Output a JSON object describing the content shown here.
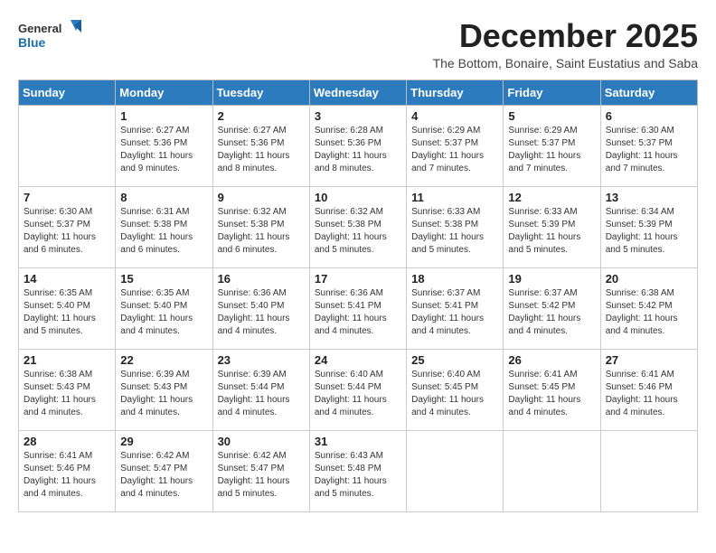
{
  "header": {
    "logo_general": "General",
    "logo_blue": "Blue",
    "title": "December 2025",
    "subtitle": "The Bottom, Bonaire, Saint Eustatius and Saba"
  },
  "weekdays": [
    "Sunday",
    "Monday",
    "Tuesday",
    "Wednesday",
    "Thursday",
    "Friday",
    "Saturday"
  ],
  "weeks": [
    [
      {
        "day": null
      },
      {
        "day": "1",
        "sunrise": "6:27 AM",
        "sunset": "5:36 PM",
        "daylight": "11 hours and 9 minutes."
      },
      {
        "day": "2",
        "sunrise": "6:27 AM",
        "sunset": "5:36 PM",
        "daylight": "11 hours and 8 minutes."
      },
      {
        "day": "3",
        "sunrise": "6:28 AM",
        "sunset": "5:36 PM",
        "daylight": "11 hours and 8 minutes."
      },
      {
        "day": "4",
        "sunrise": "6:29 AM",
        "sunset": "5:37 PM",
        "daylight": "11 hours and 7 minutes."
      },
      {
        "day": "5",
        "sunrise": "6:29 AM",
        "sunset": "5:37 PM",
        "daylight": "11 hours and 7 minutes."
      },
      {
        "day": "6",
        "sunrise": "6:30 AM",
        "sunset": "5:37 PM",
        "daylight": "11 hours and 7 minutes."
      }
    ],
    [
      {
        "day": "7",
        "sunrise": "6:30 AM",
        "sunset": "5:37 PM",
        "daylight": "11 hours and 6 minutes."
      },
      {
        "day": "8",
        "sunrise": "6:31 AM",
        "sunset": "5:38 PM",
        "daylight": "11 hours and 6 minutes."
      },
      {
        "day": "9",
        "sunrise": "6:32 AM",
        "sunset": "5:38 PM",
        "daylight": "11 hours and 6 minutes."
      },
      {
        "day": "10",
        "sunrise": "6:32 AM",
        "sunset": "5:38 PM",
        "daylight": "11 hours and 5 minutes."
      },
      {
        "day": "11",
        "sunrise": "6:33 AM",
        "sunset": "5:38 PM",
        "daylight": "11 hours and 5 minutes."
      },
      {
        "day": "12",
        "sunrise": "6:33 AM",
        "sunset": "5:39 PM",
        "daylight": "11 hours and 5 minutes."
      },
      {
        "day": "13",
        "sunrise": "6:34 AM",
        "sunset": "5:39 PM",
        "daylight": "11 hours and 5 minutes."
      }
    ],
    [
      {
        "day": "14",
        "sunrise": "6:35 AM",
        "sunset": "5:40 PM",
        "daylight": "11 hours and 5 minutes."
      },
      {
        "day": "15",
        "sunrise": "6:35 AM",
        "sunset": "5:40 PM",
        "daylight": "11 hours and 4 minutes."
      },
      {
        "day": "16",
        "sunrise": "6:36 AM",
        "sunset": "5:40 PM",
        "daylight": "11 hours and 4 minutes."
      },
      {
        "day": "17",
        "sunrise": "6:36 AM",
        "sunset": "5:41 PM",
        "daylight": "11 hours and 4 minutes."
      },
      {
        "day": "18",
        "sunrise": "6:37 AM",
        "sunset": "5:41 PM",
        "daylight": "11 hours and 4 minutes."
      },
      {
        "day": "19",
        "sunrise": "6:37 AM",
        "sunset": "5:42 PM",
        "daylight": "11 hours and 4 minutes."
      },
      {
        "day": "20",
        "sunrise": "6:38 AM",
        "sunset": "5:42 PM",
        "daylight": "11 hours and 4 minutes."
      }
    ],
    [
      {
        "day": "21",
        "sunrise": "6:38 AM",
        "sunset": "5:43 PM",
        "daylight": "11 hours and 4 minutes."
      },
      {
        "day": "22",
        "sunrise": "6:39 AM",
        "sunset": "5:43 PM",
        "daylight": "11 hours and 4 minutes."
      },
      {
        "day": "23",
        "sunrise": "6:39 AM",
        "sunset": "5:44 PM",
        "daylight": "11 hours and 4 minutes."
      },
      {
        "day": "24",
        "sunrise": "6:40 AM",
        "sunset": "5:44 PM",
        "daylight": "11 hours and 4 minutes."
      },
      {
        "day": "25",
        "sunrise": "6:40 AM",
        "sunset": "5:45 PM",
        "daylight": "11 hours and 4 minutes."
      },
      {
        "day": "26",
        "sunrise": "6:41 AM",
        "sunset": "5:45 PM",
        "daylight": "11 hours and 4 minutes."
      },
      {
        "day": "27",
        "sunrise": "6:41 AM",
        "sunset": "5:46 PM",
        "daylight": "11 hours and 4 minutes."
      }
    ],
    [
      {
        "day": "28",
        "sunrise": "6:41 AM",
        "sunset": "5:46 PM",
        "daylight": "11 hours and 4 minutes."
      },
      {
        "day": "29",
        "sunrise": "6:42 AM",
        "sunset": "5:47 PM",
        "daylight": "11 hours and 4 minutes."
      },
      {
        "day": "30",
        "sunrise": "6:42 AM",
        "sunset": "5:47 PM",
        "daylight": "11 hours and 5 minutes."
      },
      {
        "day": "31",
        "sunrise": "6:43 AM",
        "sunset": "5:48 PM",
        "daylight": "11 hours and 5 minutes."
      },
      {
        "day": null
      },
      {
        "day": null
      },
      {
        "day": null
      }
    ]
  ],
  "labels": {
    "sunrise_prefix": "Sunrise: ",
    "sunset_prefix": "Sunset: ",
    "daylight_prefix": "Daylight: "
  }
}
